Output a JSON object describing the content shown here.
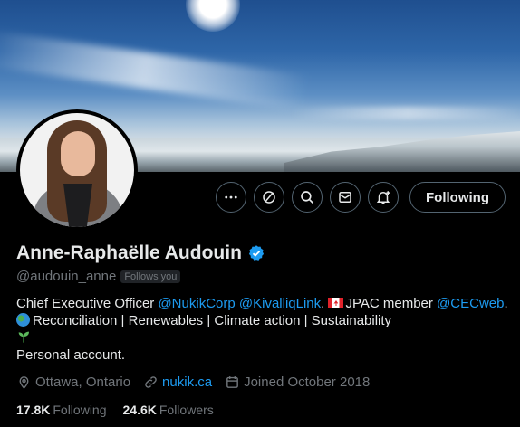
{
  "profile": {
    "name": "Anne-Raphaëlle Audouin",
    "handle": "@audouin_anne",
    "follows_you": "Follows you",
    "verified": true,
    "follow_button_label": "Following"
  },
  "actions": [
    {
      "icon": "more-icon"
    },
    {
      "icon": "grok-icon"
    },
    {
      "icon": "search-icon"
    },
    {
      "icon": "message-icon"
    },
    {
      "icon": "notification-bell-icon"
    }
  ],
  "bio": {
    "line1_prefix": "Chief Executive Officer ",
    "mention_nukik": "@NukikCorp",
    "mention_kivalliq": "@KivalliqLink",
    "line1_mid": ". ",
    "jpac_text": "JPAC member ",
    "mention_cec": "@CECweb",
    "line1_end": ".",
    "line2": "Reconciliation | Renewables | Climate action | Sustainability",
    "line4": "Personal account."
  },
  "meta": {
    "location": "Ottawa, Ontario",
    "website": "nukik.ca",
    "joined": "Joined October 2018"
  },
  "stats": {
    "following_count": "17.8K",
    "following_label": "Following",
    "followers_count": "24.6K",
    "followers_label": "Followers"
  },
  "colors": {
    "accent": "#1d9bf0",
    "muted": "#71767b",
    "text": "#e7e9ea",
    "background": "#000000",
    "border": "#536471"
  }
}
